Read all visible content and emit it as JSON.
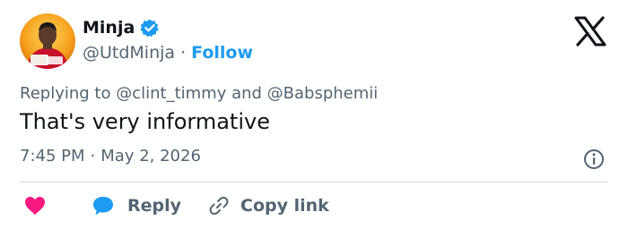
{
  "user": {
    "display_name": "Minja",
    "handle": "@UtdMinja",
    "follow_label": "Follow",
    "verified": true
  },
  "tweet": {
    "reply_line": "Replying to @clint_timmy and @Babsphemii",
    "text": "That's very informative",
    "time": "7:45 PM",
    "date": "May 2, 2026"
  },
  "actions": {
    "reply_label": "Reply",
    "copy_link_label": "Copy link"
  },
  "icons": {
    "logo": "x-logo-icon",
    "verified": "verified-badge-icon",
    "info": "info-icon",
    "like": "heart-icon",
    "reply": "speech-bubble-icon",
    "copy": "link-icon"
  },
  "colors": {
    "accent": "#1d9bf0",
    "like": "#f91880",
    "muted": "#536471",
    "text": "#0f1419"
  }
}
